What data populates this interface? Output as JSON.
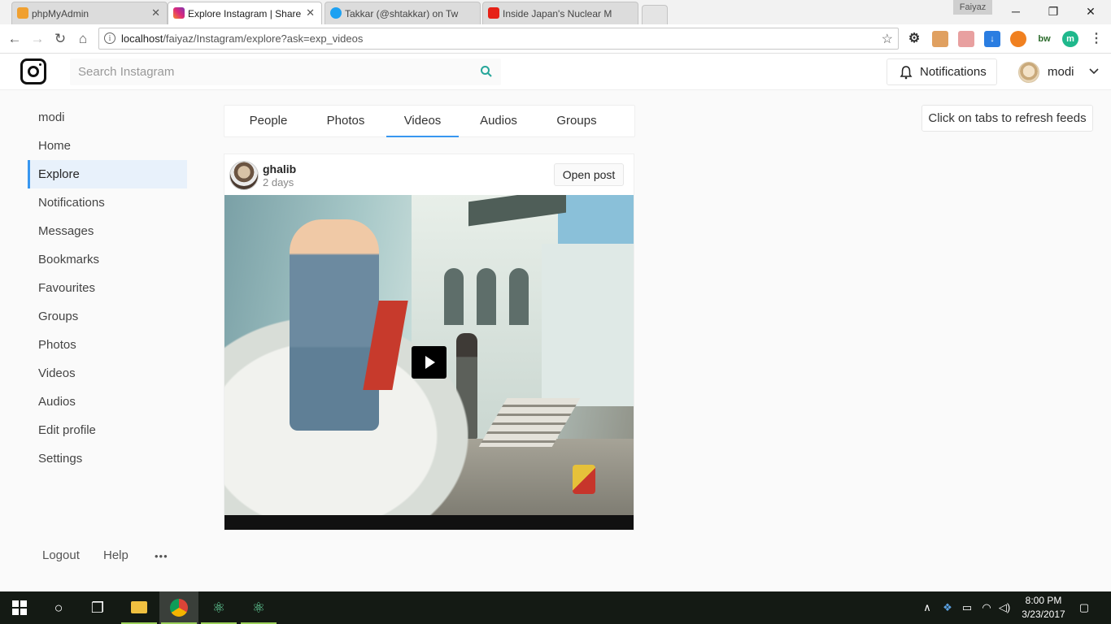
{
  "browser": {
    "tabs": [
      {
        "title": "phpMyAdmin",
        "active": false,
        "favicon_color": "#f0a030"
      },
      {
        "title": "Explore Instagram | Share",
        "active": true,
        "favicon_color": "#c13584"
      },
      {
        "title": "Takkar (@shtakkar) on Tw",
        "active": false,
        "favicon_color": "#1da1f2"
      },
      {
        "title": "Inside Japan's Nuclear M",
        "active": false,
        "favicon_color": "#e62117"
      }
    ],
    "profile_name": "Faiyaz",
    "url_host": "localhost",
    "url_path": "/faiyaz/Instagram/explore?ask=exp_videos"
  },
  "header": {
    "search_placeholder": "Search Instagram",
    "notifications_label": "Notifications",
    "username": "modi"
  },
  "sidebar": {
    "user": "modi",
    "items": [
      {
        "label": "Home",
        "active": false
      },
      {
        "label": "Explore",
        "active": true
      },
      {
        "label": "Notifications",
        "active": false
      },
      {
        "label": "Messages",
        "active": false
      },
      {
        "label": "Bookmarks",
        "active": false
      },
      {
        "label": "Favourites",
        "active": false
      },
      {
        "label": "Groups",
        "active": false
      },
      {
        "label": "Photos",
        "active": false
      },
      {
        "label": "Videos",
        "active": false
      },
      {
        "label": "Audios",
        "active": false
      },
      {
        "label": "Edit profile",
        "active": false
      },
      {
        "label": "Settings",
        "active": false
      }
    ],
    "footer": {
      "logout": "Logout",
      "help": "Help",
      "more": "•••"
    }
  },
  "feed_tabs": [
    {
      "label": "People",
      "active": false
    },
    {
      "label": "Photos",
      "active": false
    },
    {
      "label": "Videos",
      "active": true
    },
    {
      "label": "Audios",
      "active": false
    },
    {
      "label": "Groups",
      "active": false
    }
  ],
  "hint": "Click on tabs to refresh feeds",
  "post": {
    "author": "ghalib",
    "time": "2 days",
    "open_label": "Open post"
  },
  "taskbar": {
    "time": "8:00 PM",
    "date": "3/23/2017"
  },
  "colors": {
    "accent": "#3897f0",
    "active_bg": "#e8f1fb",
    "taskbar": "#141a14"
  }
}
